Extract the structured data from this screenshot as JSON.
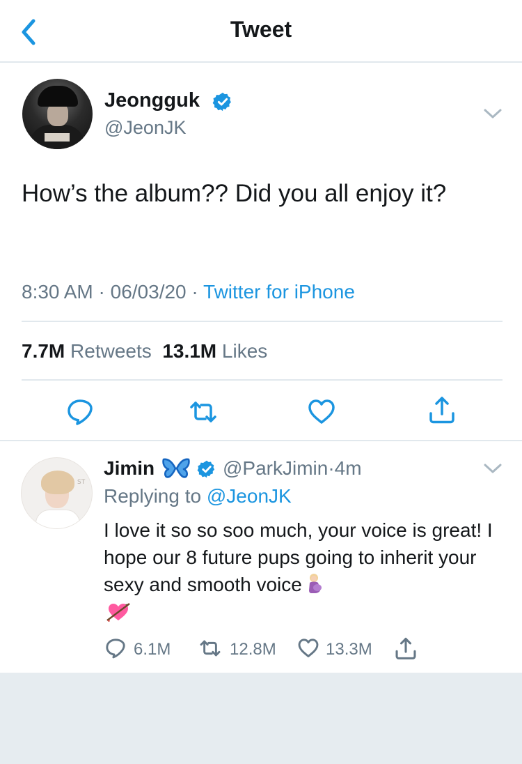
{
  "header": {
    "title": "Tweet",
    "back_icon": "chevron-left-icon"
  },
  "colors": {
    "accent": "#1b95e0",
    "secondary_text": "#657786",
    "divider": "#e1e8ed",
    "background_below": "#e6ecf0"
  },
  "tweet": {
    "author_name": "Jeongguk",
    "handle": "@JeonJK",
    "verified": true,
    "text": "How’s the album?? Did you all enjoy it?",
    "time": "8:30 AM",
    "date": "06/03/20",
    "source": "Twitter for iPhone",
    "separator": "·",
    "retweets_count": "7.7M",
    "retweets_label": "Retweets",
    "likes_count": "13.1M",
    "likes_label": "Likes",
    "actions": [
      "reply-icon",
      "retweet-icon",
      "like-icon",
      "share-icon"
    ]
  },
  "reply": {
    "author_name": "Jimin",
    "name_emoji": "butterfly-icon",
    "verified": true,
    "handle": "@ParkJimin",
    "time_ago": "4m",
    "replying_prefix": "Replying to",
    "replying_to": "@JeonJK",
    "text": "I love it so so soo much, your voice is great! I hope our 8 future pups going to inherit your sexy and smooth voice",
    "text_emojis": [
      "pregnant-woman-icon",
      "heart-with-arrow-icon"
    ],
    "reply_count": "6.1M",
    "retweet_count": "12.8M",
    "like_count": "13.3M"
  }
}
